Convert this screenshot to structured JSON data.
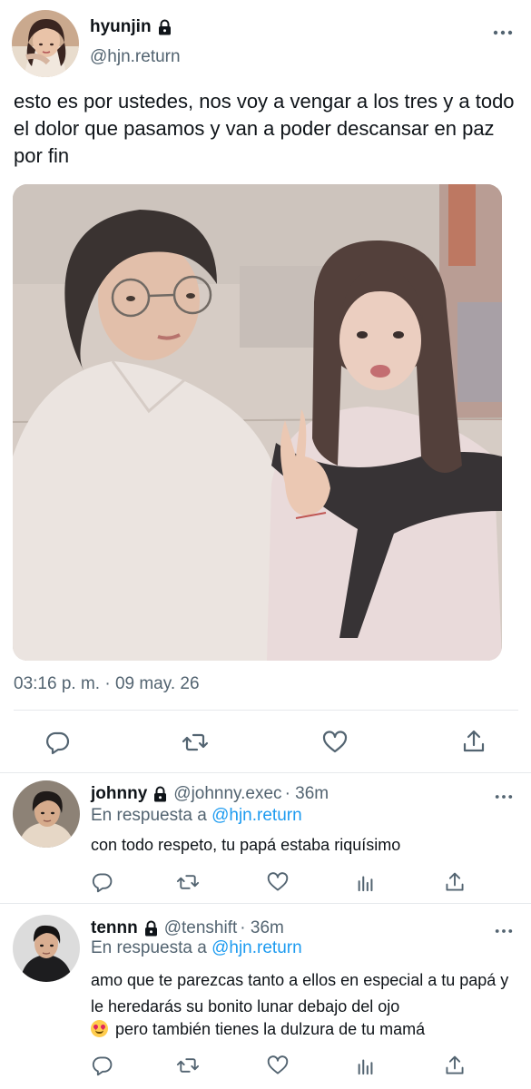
{
  "main_tweet": {
    "display_name": "hyunjin",
    "handle": "@hjn.return",
    "text": "esto es por ustedes, nos voy a vengar a los tres y a todo el dolor que pasamos y van a poder descansar en paz por fin",
    "timestamp": "03:16 p. m. · 09 may. 26",
    "more_icon": "more-dots-icon",
    "actions": [
      "reply-icon",
      "retweet-icon",
      "like-icon",
      "share-icon"
    ]
  },
  "replies": [
    {
      "display_name": "johnny",
      "handle": "@johnny.exec",
      "time": "· 36m",
      "reply_prefix": "En respuesta a",
      "reply_to": "@hjn.return",
      "text": "con todo respeto, tu papá estaba riquísimo",
      "actions": [
        "reply-icon",
        "retweet-icon",
        "like-icon",
        "analytics-icon",
        "share-icon"
      ]
    },
    {
      "display_name": "tennn",
      "handle": "@tenshift",
      "time": "· 36m",
      "reply_prefix": "En respuesta a",
      "reply_to": "@hjn.return",
      "text_line1": "amo que te parezcas tanto a ellos en especial a tu papá y le heredarás su bonito lunar debajo del ojo",
      "text_line2": "pero también tienes la dulzura de tu mamá",
      "emoji": "smiling-face-with-heart-eyes",
      "actions": [
        "reply-icon",
        "retweet-icon",
        "like-icon",
        "analytics-icon",
        "share-icon"
      ]
    }
  ],
  "colors": {
    "text": "#0f1419",
    "secondary": "#536471",
    "link": "#1d9bf0",
    "divider": "#e6e9ec"
  }
}
